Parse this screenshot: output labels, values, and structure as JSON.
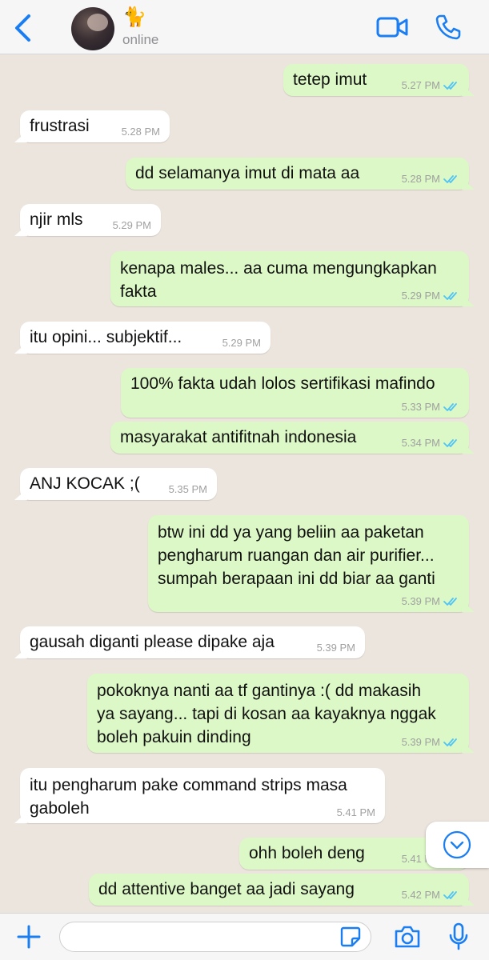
{
  "header": {
    "contact_emoji": "🐈",
    "status": "online",
    "icons": {
      "back": "chevron-left-icon",
      "video": "video-camera-icon",
      "call": "phone-icon"
    }
  },
  "colors": {
    "accent": "#1a7ef2",
    "incoming_bubble": "#ffffff",
    "outgoing_bubble": "#dcf8c6",
    "chat_background": "#ece5dd",
    "read_ticks": "#4fc3f7"
  },
  "messages": [
    {
      "dir": "out",
      "text": "tetep imut",
      "time": "5.27 PM",
      "read": true
    },
    {
      "dir": "in",
      "text": "frustrasi",
      "time": "5.28 PM"
    },
    {
      "dir": "out",
      "text": "dd selamanya imut di mata aa",
      "time": "5.28 PM",
      "read": true
    },
    {
      "dir": "in",
      "text": "njir mls",
      "time": "5.29 PM"
    },
    {
      "dir": "out",
      "lines": [
        "kenapa males... aa cuma mengungkapkan",
        "fakta"
      ],
      "time": "5.29 PM",
      "read": true
    },
    {
      "dir": "in",
      "text": "itu opini... subjektif...",
      "time": "5.29 PM"
    },
    {
      "dir": "out",
      "text": "100% fakta udah lolos sertifikasi mafindo",
      "time": "5.33 PM",
      "read": true
    },
    {
      "dir": "out",
      "text": "masyarakat antifitnah indonesia",
      "time": "5.34 PM",
      "read": true
    },
    {
      "dir": "in",
      "text": "ANJ KOCAK ;(",
      "time": "5.35 PM"
    },
    {
      "dir": "out",
      "lines": [
        "btw ini dd ya yang beliin aa paketan",
        "pengharum ruangan dan air purifier...",
        "sumpah berapaan ini dd biar aa ganti"
      ],
      "time": "5.39 PM",
      "read": true
    },
    {
      "dir": "in",
      "text": "gausah diganti please dipake aja",
      "time": "5.39 PM"
    },
    {
      "dir": "out",
      "lines": [
        "pokoknya nanti aa tf gantinya :( dd makasih",
        "ya sayang... tapi di kosan aa kayaknya nggak",
        "boleh pakuin dinding"
      ],
      "time": "5.39 PM",
      "read": true
    },
    {
      "dir": "in",
      "lines": [
        "itu pengharum pake command strips masa",
        "gaboleh"
      ],
      "time": "5.41 PM"
    },
    {
      "dir": "out",
      "text": "ohh boleh deng",
      "time": "5.41 PM",
      "read": true
    },
    {
      "dir": "out",
      "text": "dd attentive banget aa jadi sayang",
      "time": "5.42 PM",
      "read": true
    }
  ],
  "scroll_button_icon": "chevron-down-circle-icon",
  "input_bar": {
    "message_value": "",
    "icons": {
      "add": "plus-icon",
      "sticker": "sticker-icon",
      "camera": "camera-icon",
      "mic": "microphone-icon"
    }
  }
}
